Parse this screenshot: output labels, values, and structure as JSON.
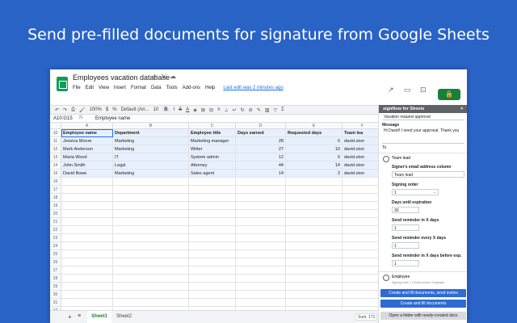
{
  "headline": "Send pre-filled documents for signature from Google Sheets",
  "app": {
    "doc_title": "Employees vacation database",
    "menus": [
      "File",
      "Edit",
      "View",
      "Insert",
      "Format",
      "Data",
      "Tools",
      "Add-ons",
      "Help"
    ],
    "last_edit": "Last edit was 2 minutes ago",
    "share_icon": "lock-icon"
  },
  "toolbar": {
    "zoom": "100%",
    "font": "Default (Ari...",
    "font_size": "10",
    "bold": "B",
    "italic": "I",
    "strike": "S",
    "text_color": "A"
  },
  "formula_bar": {
    "cell_ref": "A10:G15",
    "fx": "fx",
    "value": "Employee name"
  },
  "grid": {
    "columns": [
      "A",
      "B",
      "C",
      "D",
      "E",
      "F"
    ],
    "row_numbers": [
      "10",
      "11",
      "12",
      "13",
      "14",
      "15",
      "16",
      "17",
      "18",
      "19",
      "20",
      "21",
      "22",
      "23",
      "24",
      "25",
      "26",
      "27",
      "28",
      "29",
      "30",
      "31",
      "32"
    ],
    "headers": [
      "Employee name",
      "Department",
      "Employee title",
      "Days earned",
      "Requested days",
      "Team lea"
    ],
    "rows": [
      [
        "Jessica Moore",
        "Marketing",
        "Marketing manager",
        "28",
        "6",
        "david.ston"
      ],
      [
        "Mark Anderson",
        "Marketing",
        "Writer",
        "27",
        "10",
        "david.ston"
      ],
      [
        "Maria Wood",
        "IT",
        "System admin",
        "12",
        "6",
        "david.ston"
      ],
      [
        "John Smith",
        "Legal",
        "Attorney",
        "44",
        "14",
        "david.ston"
      ],
      [
        "David Bowe",
        "Marketing",
        "Sales agent",
        "14",
        "2",
        "david.ston"
      ]
    ]
  },
  "sheets": {
    "plus": "+",
    "list": "≡",
    "tabs": [
      "Sheet1",
      "Sheet2"
    ],
    "sum": "Sum: 171"
  },
  "panel": {
    "title": "signNow for Sheets",
    "close": "✕",
    "subject_value": "Vacation request approval",
    "message_label": "Message",
    "message_value": "Hi David! I need your approval. Thank you",
    "to_label": "To",
    "recipient1_role": "Team lead",
    "signer_email_label": "Signer's email address column",
    "signer_email_value": "Team lead",
    "signing_order_label": "Signing order",
    "signing_order_value": "1",
    "days_exp_label": "Days until expiration",
    "days_exp_value": "30",
    "reminder_label": "Send reminder in X days",
    "reminder_value": "1",
    "reminder_every_label": "Send reminder every X days",
    "reminder_every_value": "1",
    "reminder_before_label": "Send reminder in X days before exp.",
    "reminder_before_value": "1",
    "recipient2_role": "Employee",
    "recipient2_sub": "Signing order 1 | Email column: Employee",
    "btn_send": "Create and fill documents, send invites",
    "btn_create": "Create and fill documents",
    "btn_folder": "Open a folder with newly-created docs"
  },
  "colors": {
    "background": "#2a63c6",
    "sheets_green": "#188038",
    "selection": "#e8f0fe",
    "primary_button": "#2e6bd4"
  }
}
